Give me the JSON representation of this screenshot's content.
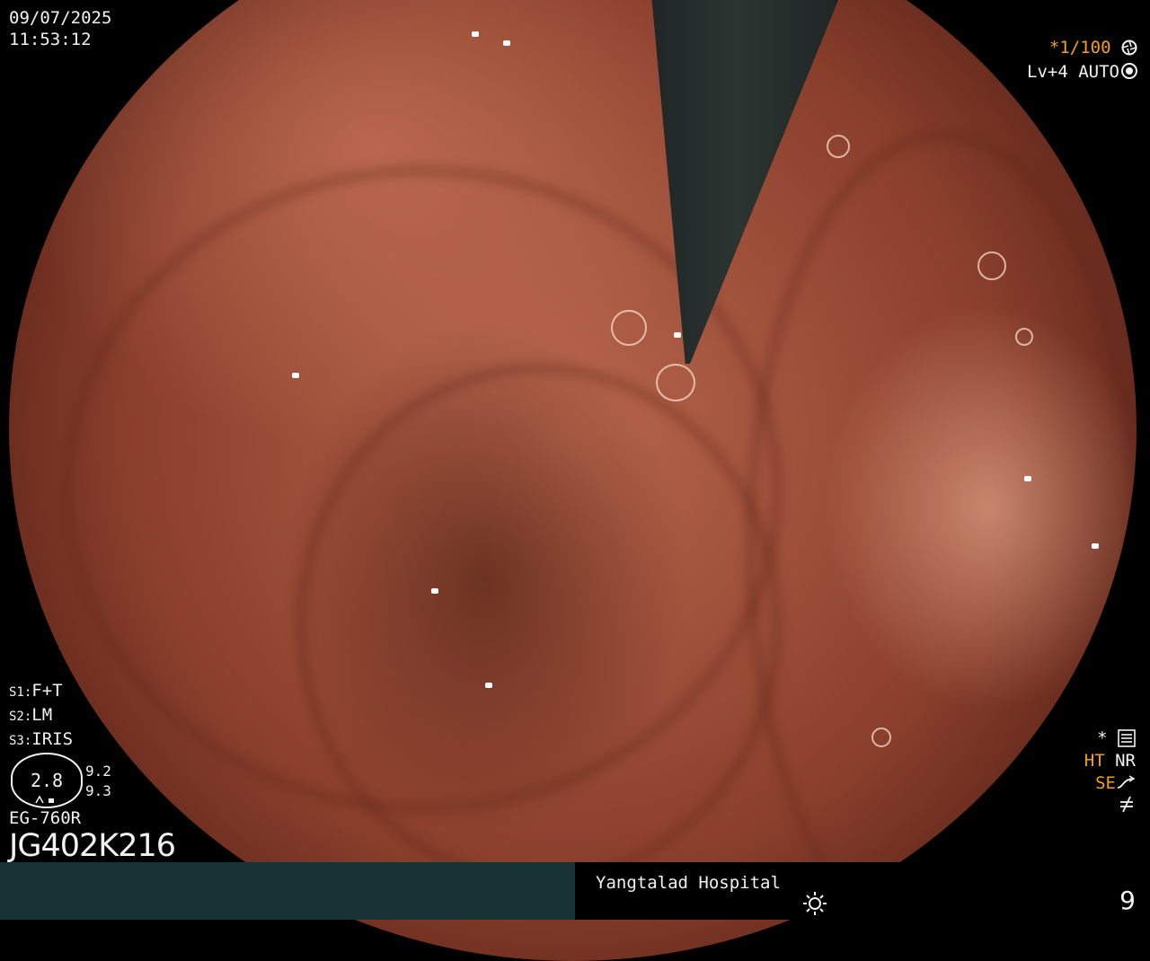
{
  "overlay": {
    "date": "09/07/2025",
    "time": "11:53:12",
    "shutter": "*1/100",
    "shutter_icon": "aperture-icon",
    "level": "Lv+4",
    "exposure_mode": "AUTO",
    "exposure_icon": "ring-icon",
    "settings": [
      {
        "label": "S1:",
        "value": "F+T"
      },
      {
        "label": "S2:",
        "value": "LM"
      },
      {
        "label": "S3:",
        "value": "IRIS"
      }
    ],
    "dial_value": "2.8",
    "dial_side": [
      "9.2",
      "9.3"
    ],
    "scope_model": "EG-760R",
    "serial": "JG402K216",
    "status": {
      "star": "*",
      "ht": "HT",
      "nr": "NR",
      "se": "SE"
    },
    "hospital": "Yangtalad Hospital",
    "image_count": "9"
  },
  "colors": {
    "osd_text": "#f2f2f2",
    "accent_orange": "#f0a020",
    "bottom_bar_left": "#173234",
    "tissue": "#b8664c"
  }
}
